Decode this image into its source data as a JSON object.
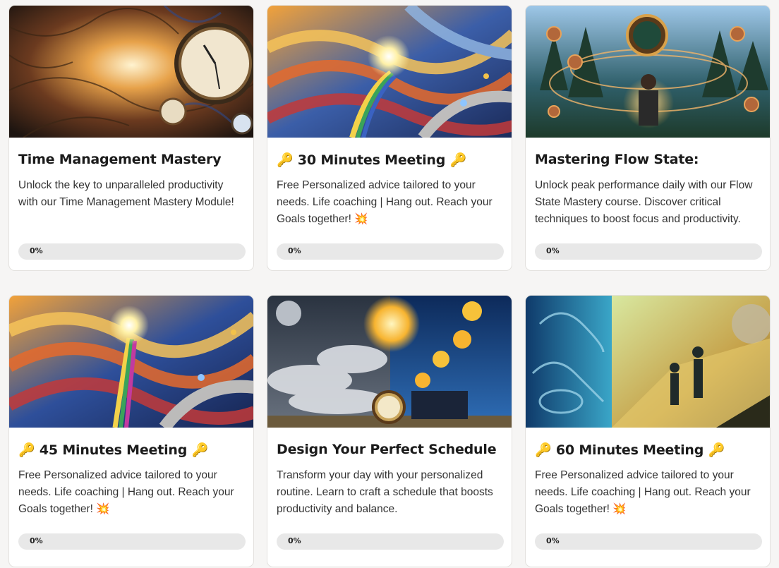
{
  "courses": [
    {
      "title": "Time Management Mastery",
      "emoji_prefix": "",
      "emoji_suffix": "",
      "description": "Unlock the key to unparalleled productivity with our Time Management Mastery Module!",
      "progress_label": "0%",
      "progress": 0,
      "thumbnail_icon": "clock-art"
    },
    {
      "title": "30 Minutes Meeting",
      "emoji_prefix": "🔑",
      "emoji_suffix": "🔑",
      "description": "Free Personalized advice tailored to your needs. Life coaching | Hang out. Reach your Goals together! 💥",
      "progress_label": "0%",
      "progress": 0,
      "thumbnail_icon": "swirl-art"
    },
    {
      "title": "Mastering Flow State:",
      "emoji_prefix": "",
      "emoji_suffix": "",
      "description": "Unlock peak performance daily with our Flow State Mastery course. Discover critical techniques to boost focus and productivity.",
      "progress_label": "0%",
      "progress": 0,
      "thumbnail_icon": "meditation-art"
    },
    {
      "title": "45 Minutes Meeting",
      "emoji_prefix": "🔑",
      "emoji_suffix": "🔑",
      "description": "Free Personalized advice tailored to your needs. Life coaching | Hang out. Reach your Goals together! 💥",
      "progress_label": "0%",
      "progress": 0,
      "thumbnail_icon": "swirl-art"
    },
    {
      "title": "Design Your Perfect Schedule",
      "emoji_prefix": "",
      "emoji_suffix": "",
      "description": "Transform your day with your personalized routine. Learn to craft a schedule that boosts productivity and balance.",
      "progress_label": "0%",
      "progress": 0,
      "thumbnail_icon": "night-day-art"
    },
    {
      "title": "60 Minutes Meeting",
      "emoji_prefix": "🔑",
      "emoji_suffix": "🔑",
      "description": "Free Personalized advice tailored to your needs. Life coaching | Hang out. Reach your Goals together! 💥",
      "progress_label": "0%",
      "progress": 0,
      "thumbnail_icon": "walkers-art"
    }
  ],
  "colors": {
    "page_background": "#f6f5f4",
    "card_background": "#ffffff",
    "progress_track": "#e8e8e8",
    "progress_fill": "#4a7bd0"
  }
}
